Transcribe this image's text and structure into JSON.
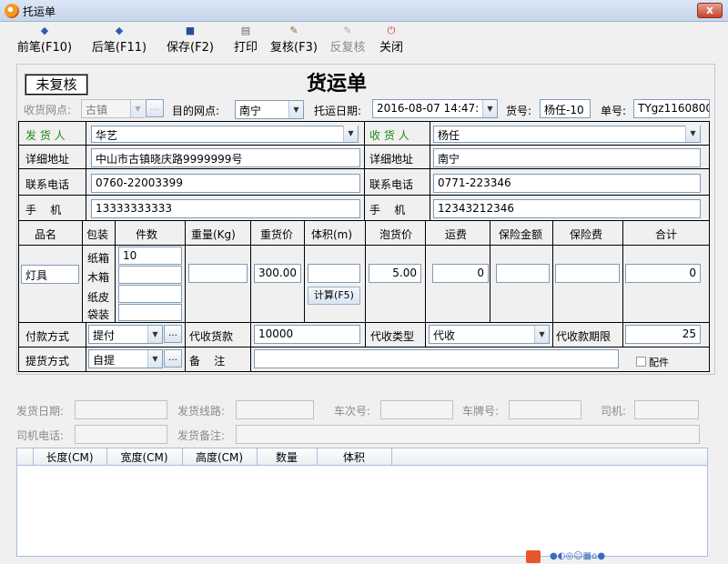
{
  "window": {
    "title": "托运单",
    "close": "x"
  },
  "toolbar": {
    "prev": "前笔(F10)",
    "next": "后笔(F11)",
    "save": "保存(F2)",
    "print": "打印",
    "review": "复核(F3)",
    "unreview": "反复核",
    "close": "关闭"
  },
  "form": {
    "status": "未复核",
    "title": "货运单",
    "from_branch_label": "收货网点:",
    "from_branch_value": "古镇",
    "dest_branch_label": "目的网点:",
    "dest_branch_value": "南宁",
    "ship_date_label": "托运日期:",
    "ship_date_value": "2016-08-07 14:47:",
    "cargo_no_label": "货号:",
    "cargo_no_value": "杨任-10",
    "order_no_label": "单号:",
    "order_no_value": "TYgz1160800",
    "sender_label": "发 货 人",
    "sender_value": "华艺",
    "receiver_label": "收 货 人",
    "receiver_value": "杨任",
    "addr_label": "详细地址",
    "sender_addr": "中山市古镇晓庆路9999999号",
    "receiver_addr": "南宁",
    "phone_label": "联系电话",
    "sender_phone": "0760-22003399",
    "receiver_phone": "0771-223346",
    "mobile_label": "手    机",
    "sender_mobile": "13333333333",
    "receiver_mobile": "12343212346"
  },
  "goods": {
    "headers": [
      "品名",
      "包装",
      "件数",
      "重量(Kg)",
      "重货价",
      "体积(m)",
      "泡货价",
      "运费",
      "保险金额",
      "保险费",
      "合计"
    ],
    "name": "灯具",
    "packages": [
      {
        "type": "纸箱",
        "count": "10"
      },
      {
        "type": "木箱",
        "count": ""
      },
      {
        "type": "纸皮",
        "count": ""
      },
      {
        "type": "袋装",
        "count": ""
      }
    ],
    "weight": "",
    "heavy_price": "300.00",
    "volume": "",
    "light_price": "5.00",
    "freight": "0",
    "insured_amount": "",
    "insurance_fee": "",
    "total": "0",
    "calc_button": "计算(F5)"
  },
  "payment": {
    "pay_label": "付款方式",
    "pay_value": "提付",
    "cod_label": "代收货款",
    "cod_value": "10000",
    "cod_type_label": "代收类型",
    "cod_type_value": "代收",
    "cod_term_label": "代收款期限",
    "cod_term_value": "25",
    "pickup_label": "提货方式",
    "pickup_value": "自提",
    "remark_label": "备    注",
    "remark_value": "",
    "parts_label": "配件"
  },
  "dispatch": {
    "date_label": "发货日期:",
    "route_label": "发货线路:",
    "train_label": "车次号:",
    "plate_label": "车牌号:",
    "driver_label": "司机:",
    "driver_phone_label": "司机电话:",
    "remark_label": "发货备注:"
  },
  "grid": {
    "headers": [
      "长度(CM)",
      "宽度(CM)",
      "高度(CM)",
      "数量",
      "体积"
    ]
  }
}
